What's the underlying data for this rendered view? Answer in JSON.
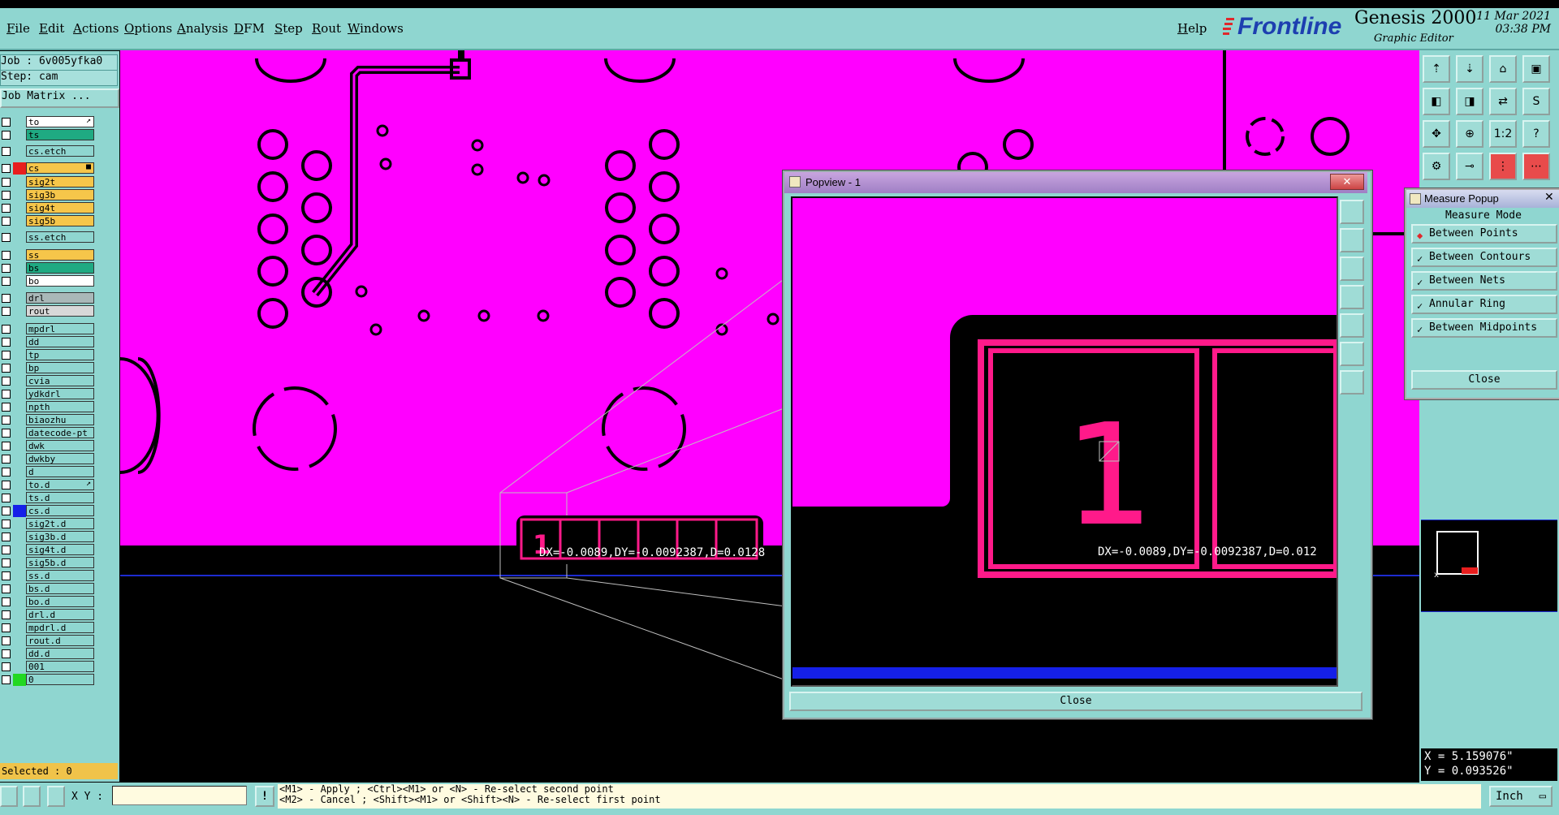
{
  "menubar": {
    "items": [
      "File",
      "Edit",
      "Actions",
      "Options",
      "Analysis",
      "DFM",
      "Step",
      "Rout",
      "Windows"
    ],
    "help": "Help"
  },
  "branding": {
    "brand": "Frontline",
    "product": "Genesis 2000",
    "subtitle": "Graphic Editor",
    "date": "11 Mar 2021",
    "time": "03:38 PM"
  },
  "left_panel": {
    "job": "Job : 6v005yfka0",
    "step": "Step: cam",
    "job_matrix": "Job Matrix ...",
    "selected": "Selected : 0",
    "layers": [
      {
        "name": "to",
        "color": "#ffffff",
        "swatch": "",
        "mark": "↗"
      },
      {
        "name": "ts",
        "color": "#1faa82",
        "swatch": ""
      },
      {
        "name": "cs.etch",
        "color": "#8fd6d0",
        "swatch": ""
      },
      {
        "name": "cs",
        "color": "#f6c64a",
        "swatch": "#e81e1e",
        "mark": "■"
      },
      {
        "name": "sig2t",
        "color": "#f6c64a",
        "swatch": ""
      },
      {
        "name": "sig3b",
        "color": "#f6c64a",
        "swatch": ""
      },
      {
        "name": "sig4t",
        "color": "#f6c64a",
        "swatch": ""
      },
      {
        "name": "sig5b",
        "color": "#f6c64a",
        "swatch": ""
      },
      {
        "name": "ss.etch",
        "color": "#8fd6d0",
        "swatch": ""
      },
      {
        "name": "ss",
        "color": "#f6c64a",
        "swatch": ""
      },
      {
        "name": "bs",
        "color": "#1faa82",
        "swatch": ""
      },
      {
        "name": "bo",
        "color": "#ffffff",
        "swatch": ""
      },
      {
        "name": "drl",
        "color": "#a9b8b8",
        "swatch": ""
      },
      {
        "name": "rout",
        "color": "#d8d8d8",
        "swatch": ""
      },
      {
        "name": "mpdrl",
        "color": "#8fd6d0",
        "swatch": ""
      },
      {
        "name": "dd",
        "color": "#8fd6d0",
        "swatch": ""
      },
      {
        "name": "tp",
        "color": "#8fd6d0",
        "swatch": ""
      },
      {
        "name": "bp",
        "color": "#8fd6d0",
        "swatch": ""
      },
      {
        "name": "cvia",
        "color": "#8fd6d0",
        "swatch": ""
      },
      {
        "name": "ydkdrl",
        "color": "#8fd6d0",
        "swatch": ""
      },
      {
        "name": "npth",
        "color": "#8fd6d0",
        "swatch": ""
      },
      {
        "name": "biaozhu",
        "color": "#8fd6d0",
        "swatch": ""
      },
      {
        "name": "datecode-pt",
        "color": "#8fd6d0",
        "swatch": ""
      },
      {
        "name": "dwk",
        "color": "#8fd6d0",
        "swatch": ""
      },
      {
        "name": "dwkby",
        "color": "#8fd6d0",
        "swatch": ""
      },
      {
        "name": "d",
        "color": "#8fd6d0",
        "swatch": ""
      },
      {
        "name": "to.d",
        "color": "#8fd6d0",
        "swatch": "",
        "mark": "↗"
      },
      {
        "name": "ts.d",
        "color": "#8fd6d0",
        "swatch": ""
      },
      {
        "name": "cs.d",
        "color": "#8fd6d0",
        "swatch": "#1520e8"
      },
      {
        "name": "sig2t.d",
        "color": "#8fd6d0",
        "swatch": ""
      },
      {
        "name": "sig3b.d",
        "color": "#8fd6d0",
        "swatch": ""
      },
      {
        "name": "sig4t.d",
        "color": "#8fd6d0",
        "swatch": ""
      },
      {
        "name": "sig5b.d",
        "color": "#8fd6d0",
        "swatch": ""
      },
      {
        "name": "ss.d",
        "color": "#8fd6d0",
        "swatch": ""
      },
      {
        "name": "bs.d",
        "color": "#8fd6d0",
        "swatch": ""
      },
      {
        "name": "bo.d",
        "color": "#8fd6d0",
        "swatch": ""
      },
      {
        "name": "drl.d",
        "color": "#8fd6d0",
        "swatch": ""
      },
      {
        "name": "mpdrl.d",
        "color": "#8fd6d0",
        "swatch": ""
      },
      {
        "name": "rout.d",
        "color": "#8fd6d0",
        "swatch": ""
      },
      {
        "name": "dd.d",
        "color": "#8fd6d0",
        "swatch": ""
      },
      {
        "name": "001",
        "color": "#8fd6d0",
        "swatch": ""
      },
      {
        "name": "0",
        "color": "#8fd6d0",
        "swatch": "#22d822"
      }
    ]
  },
  "canvas": {
    "measure_text": "DX=-0.0089,DY=-0.0092387,D=0.0128",
    "board_color": "#ff00ff",
    "background": "#000000",
    "label": "1"
  },
  "popview": {
    "title": "Popview - 1",
    "measure_text": "DX=-0.0089,DY=-0.0092387,D=0.012",
    "label": "1",
    "close": "Close"
  },
  "measure_popup": {
    "title": "Measure Popup",
    "heading": "Measure Mode",
    "options": [
      "Between Points",
      "Between Contours",
      "Between Nets",
      "Annular Ring",
      "Between Midpoints"
    ],
    "selected_index": 0,
    "close": "Close"
  },
  "coords": {
    "x": "X = 5.159076\"",
    "y": "Y = 0.093526\""
  },
  "status": {
    "xy_label": "X Y :",
    "xy_value": "",
    "prompt_line1": "<M1> - Apply  ; <Ctrl><M1> or <N> - Re-select second point",
    "prompt_line2": "<M2> - Cancel ; <Shift><M1> or <Shift><N> - Re-select first point",
    "units": "Inch"
  },
  "icons": {
    "right_toolbar": [
      "layer-up-icon",
      "layer-down-icon",
      "home-icon",
      "zoom-window-icon",
      "pan-left-icon",
      "pan-right-icon",
      "mirror-icon",
      "step-s-icon",
      "zoom-fit-icon",
      "zoom-center-icon",
      "scale-1-2-icon",
      "help-icon",
      "settings-icon",
      "probe-icon",
      "snap-icon",
      "net-icon"
    ]
  }
}
